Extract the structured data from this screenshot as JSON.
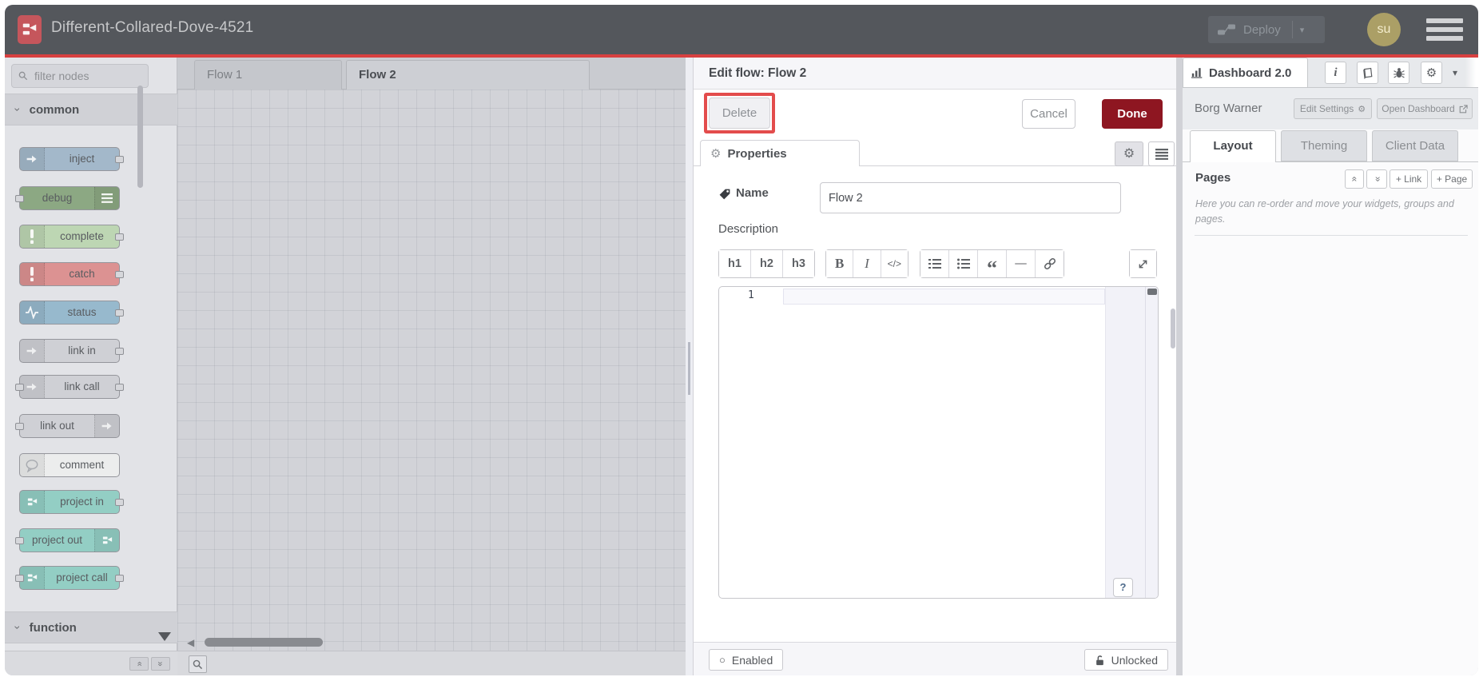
{
  "header": {
    "title": "Different-Collared-Dove-4521",
    "deploy_label": "Deploy",
    "avatar": "su"
  },
  "palette": {
    "filter_placeholder": "filter nodes",
    "category_common": "common",
    "category_function": "function",
    "nodes": [
      {
        "label": "inject",
        "color": "#a3b8ca",
        "icon": "arrow-in",
        "icon_side": "left",
        "ports": "right"
      },
      {
        "label": "debug",
        "color": "#8ca883",
        "icon": "list",
        "icon_side": "right",
        "ports": "left"
      },
      {
        "label": "complete",
        "color": "#bdd6b3",
        "icon": "exclamation",
        "icon_side": "left",
        "ports": "right"
      },
      {
        "label": "catch",
        "color": "#dc9292",
        "icon": "exclamation",
        "icon_side": "left",
        "ports": "right"
      },
      {
        "label": "status",
        "color": "#97b9cd",
        "icon": "zigzag",
        "icon_side": "left",
        "ports": "right"
      },
      {
        "label": "link in",
        "color": "#cfd0d5",
        "icon": "link-arrow",
        "icon_side": "left",
        "ports": "right"
      },
      {
        "label": "link call",
        "color": "#cfd0d5",
        "icon": "link-arrow",
        "icon_side": "left",
        "ports": "both"
      },
      {
        "label": "link out",
        "color": "#cfd0d5",
        "icon": "link-arrow",
        "icon_side": "right",
        "ports": "left"
      },
      {
        "label": "comment",
        "color": "#eceded",
        "icon": "bubble",
        "icon_side": "left",
        "ports": "none"
      },
      {
        "label": "project in",
        "color": "#93cec4",
        "icon": "project",
        "icon_side": "left",
        "ports": "right"
      },
      {
        "label": "project out",
        "color": "#93cec4",
        "icon": "project",
        "icon_side": "right",
        "ports": "left"
      },
      {
        "label": "project call",
        "color": "#93cec4",
        "icon": "project",
        "icon_side": "left",
        "ports": "both"
      }
    ]
  },
  "workspace": {
    "tabs": [
      {
        "label": "Flow 1",
        "active": false
      },
      {
        "label": "Flow 2",
        "active": true
      }
    ]
  },
  "dialog": {
    "title": "Edit flow: Flow 2",
    "delete_label": "Delete",
    "cancel_label": "Cancel",
    "done_label": "Done",
    "properties_tab": "Properties",
    "name_label": "Name",
    "name_value": "Flow 2",
    "description_label": "Description",
    "toolbar": {
      "h1": "h1",
      "h2": "h2",
      "h3": "h3",
      "bold": "B",
      "italic": "I",
      "code": "</>"
    },
    "editor_line": "1",
    "help_label": "?",
    "enabled_label": "Enabled",
    "unlocked_label": "Unlocked"
  },
  "sidebar": {
    "dashboard_tab": "Dashboard 2.0",
    "project_name": "Borg Warner",
    "edit_settings_label": "Edit Settings",
    "open_dashboard_label": "Open Dashboard",
    "tabs": [
      {
        "label": "Layout",
        "active": true
      },
      {
        "label": "Theming",
        "active": false
      },
      {
        "label": "Client Data",
        "active": false
      }
    ],
    "pages_heading": "Pages",
    "add_link_label": "+ Link",
    "add_page_label": "+ Page",
    "hint": "Here you can re-order and move your widgets, groups and pages."
  },
  "icons": {
    "gear": "⚙",
    "circle": "○",
    "dropdown": "▾",
    "double_chevron": "«",
    "chevron": "›",
    "quote": "“",
    "hr": "—",
    "left_arrow": "◀"
  },
  "colors": {
    "annotation_red": "#e34c4c",
    "done_red": "#8e1621",
    "header_red_line": "#d84040",
    "logo_red": "#c5565c",
    "avatar_olive": "#ab9f66"
  }
}
